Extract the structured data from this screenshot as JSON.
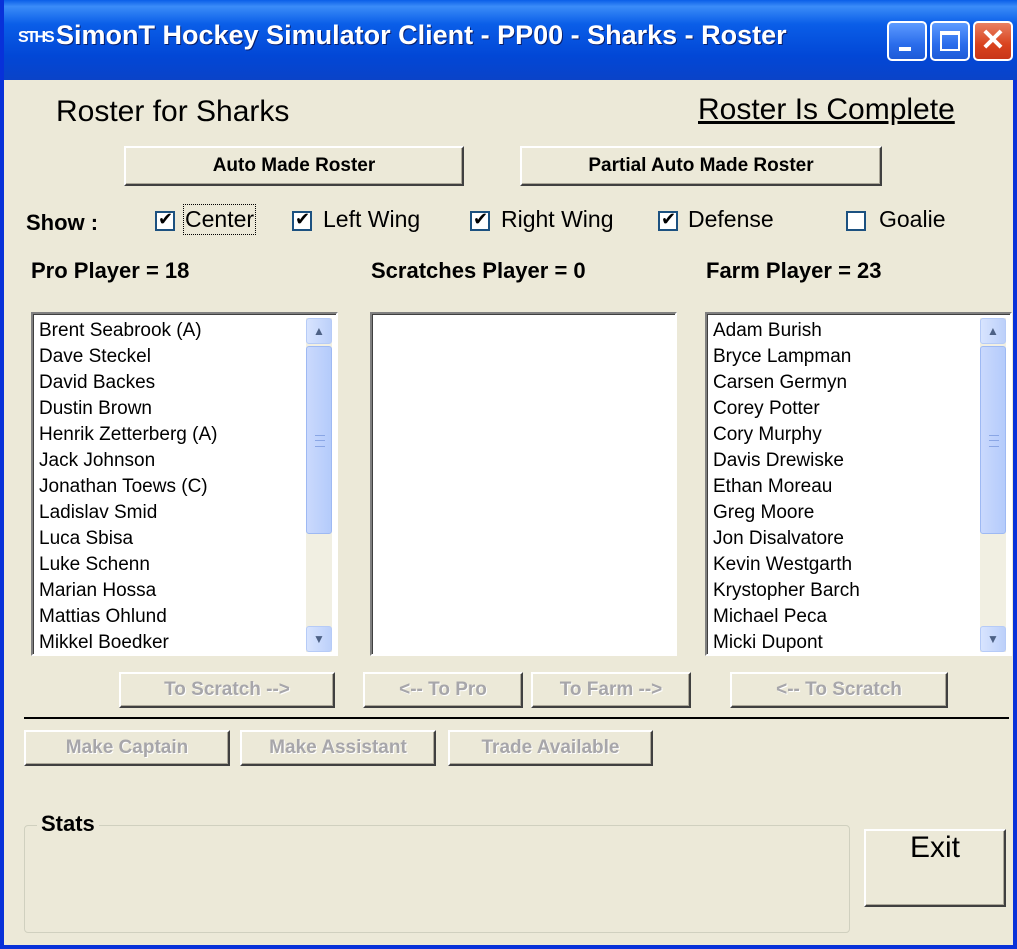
{
  "window": {
    "icon_text": "STHS",
    "title": "SimonT Hockey Simulator Client - PP00 - Sharks - Roster",
    "controls": {
      "minimize_icon": "minimize-icon",
      "maximize_icon": "maximize-icon",
      "close_icon": "close-icon",
      "close_glyph": "✕"
    }
  },
  "header": {
    "roster_title": "Roster for Sharks",
    "status": "Roster Is Complete"
  },
  "actions": {
    "auto": "Auto Made Roster",
    "partial": "Partial Auto Made Roster"
  },
  "filters": {
    "label": "Show :",
    "items": [
      {
        "label": "Center",
        "checked": true
      },
      {
        "label": "Left Wing",
        "checked": true
      },
      {
        "label": "Right Wing",
        "checked": true
      },
      {
        "label": "Defense",
        "checked": true
      },
      {
        "label": "Goalie",
        "checked": false
      }
    ],
    "check_glyph": "✔"
  },
  "columns": {
    "pro": "Pro Player = 18",
    "scratches": "Scratches Player = 0",
    "farm": "Farm Player = 23"
  },
  "lists": {
    "pro": [
      "Brent Seabrook (A)",
      "Dave Steckel",
      "David Backes",
      "Dustin Brown",
      "Henrik Zetterberg (A)",
      "Jack Johnson",
      "Jonathan Toews (C)",
      "Ladislav Smid",
      "Luca Sbisa",
      "Luke Schenn",
      "Marian Hossa",
      "Mattias Ohlund",
      "Mikkel Boedker"
    ],
    "scratches": [],
    "farm": [
      "Adam Burish",
      "Bryce Lampman",
      "Carsen Germyn",
      "Corey Potter",
      "Cory Murphy",
      "Davis Drewiske",
      "Ethan Moreau",
      "Greg Moore",
      "Jon Disalvatore",
      "Kevin Westgarth",
      "Krystopher Barch",
      "Michael Peca",
      "Micki Dupont"
    ]
  },
  "move_buttons": {
    "to_scratch": "To Scratch -->",
    "to_pro": "<-- To Pro",
    "to_farm": "To Farm -->",
    "back_to_scratch": "<-- To Scratch"
  },
  "player_buttons": {
    "captain": "Make Captain",
    "assistant": "Make Assistant",
    "trade": "Trade Available"
  },
  "stats": {
    "legend": "Stats"
  },
  "exit": "Exit",
  "colors": {
    "titlebar": "#0A5EE8",
    "face": "#ECE9D8",
    "disabled_text": "#A7A6AA"
  }
}
